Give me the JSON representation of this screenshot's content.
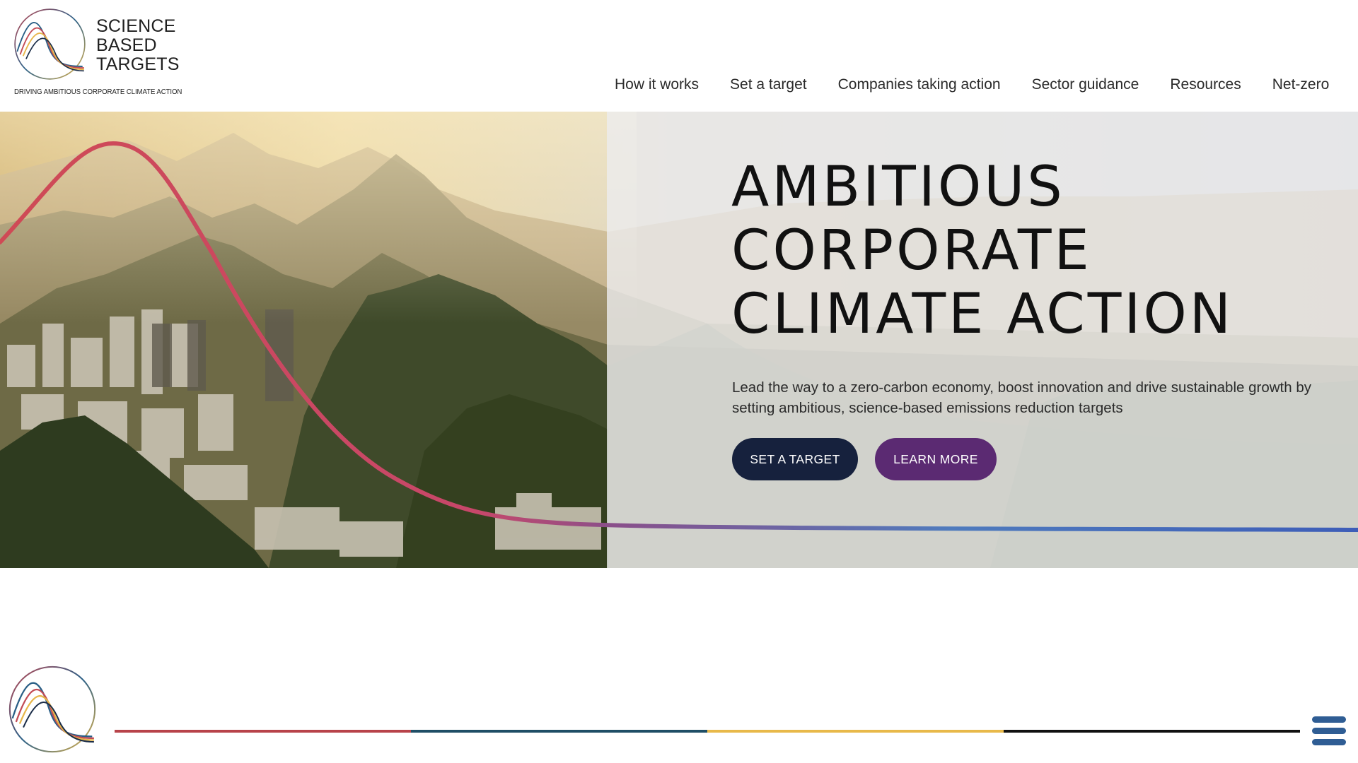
{
  "brand": {
    "name_lines": [
      "SCIENCE",
      "BASED",
      "TARGETS"
    ],
    "tagline": "DRIVING AMBITIOUS CORPORATE CLIMATE ACTION"
  },
  "nav": {
    "items": [
      "How it works",
      "Set a target",
      "Companies taking action",
      "Sector guidance",
      "Resources",
      "Net-zero"
    ]
  },
  "hero": {
    "title_lines": [
      "AMBITIOUS",
      "CORPORATE",
      "CLIMATE ACTION"
    ],
    "subtitle": "Lead the way to a zero-carbon economy, boost innovation and drive sustainable growth by setting ambitious, science-based emissions reduction targets",
    "primary_button": "SET A TARGET",
    "secondary_button": "LEARN MORE"
  },
  "colors": {
    "primary_button": "#16213d",
    "secondary_button": "#5b2a72",
    "divider": [
      "#b8434a",
      "#1f4e66",
      "#e8b94a",
      "#111111"
    ],
    "menu_icon": "#2f5d94"
  },
  "icons": {
    "logo": "sbt-logo-mark",
    "menu": "hamburger-menu-icon"
  }
}
